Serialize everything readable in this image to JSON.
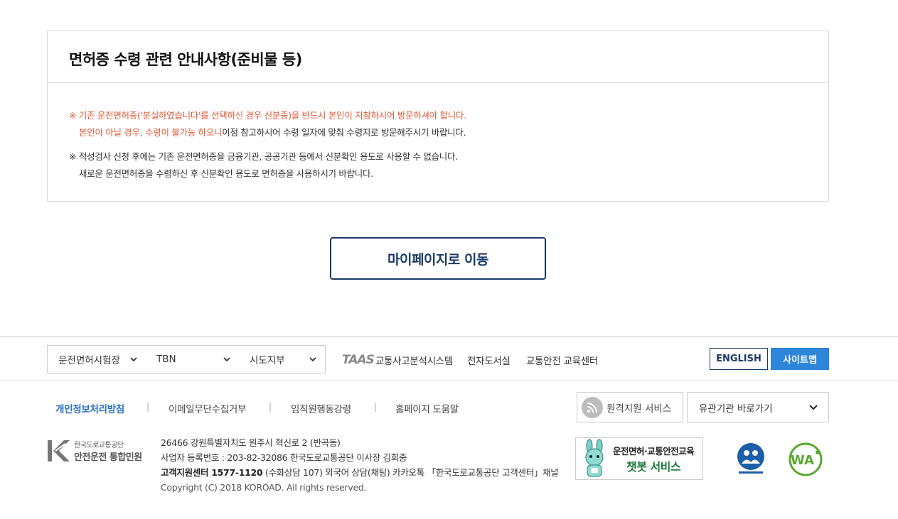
{
  "notice": {
    "title": "면허증 수령 관련 안내사항(준비물 등)",
    "p1_line1": "※ 기존 운전면허증('분실하였습니다'를 선택하신 경우 신분증)을 반드시 본인이 지참하시어 방문하셔야 합니다.",
    "p1_line2_red": "본인이 아닐 경우, 수령이 불가능 하오니",
    "p1_line2_dark": "이점 참고하시어 수령 일자에 맞춰 수령지로 방문해주시기 바랍니다.",
    "p2_line1": "※ 적성검사 신청 후에는 기존 운전면허증을 금융기관, 공공기관 등에서 신분확인 용도로 사용할 수 없습니다.",
    "p2_line2": "새로운 운전면허증을 수령하신 후 신분확인 용도로 면허증을 사용하시기 바랍니다."
  },
  "mypage_button": "마이페이지로 이동",
  "footer": {
    "selects": [
      "운전면허시험장",
      "TBN",
      "시도지부"
    ],
    "taas_logo": "TAAS",
    "taas_label": "교통사고분석시스템",
    "links": [
      "전자도서실",
      "교통안전 교육센터"
    ],
    "english": "ENGLISH",
    "sitemap": "사이트맵",
    "policy_links": [
      "개인정보처리방침",
      "이메일무단수집거부",
      "임직원행동강령",
      "홈페이지 도움말"
    ],
    "separator": "|",
    "remote_service": "원격지원 서비스",
    "related_orgs": "유관기관 바로가기",
    "logo_line1": "한국도로교통공단",
    "logo_line2": "안전운전 통합민원",
    "address": "26466 강원특별자치도 원주시 혁신로 2 (반곡동)",
    "business": "사업자 등록번호 : 203-82-32086 한국도로교통공단 이사장 김희중",
    "call_center_label": "고객지원센터 1577-1120",
    "call_center_detail": " (수화상담 107) 외국어 상담(채팅) 카카오톡 「한국도로교통공단 고객센터」채널",
    "copyright": "Copyright (C) 2018 KOROAD. All rights reserved.",
    "chatbot_line1": "운전면허·교통안전교육",
    "chatbot_line2": "챗봇 서비스"
  },
  "colors": {
    "navy": "#1b3a66",
    "blue": "#2d86d9",
    "red": "#e05a3a"
  }
}
